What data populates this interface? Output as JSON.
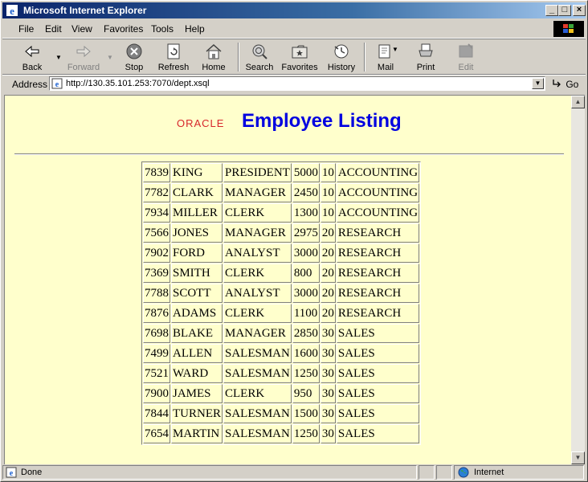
{
  "window": {
    "title": "Microsoft Internet Explorer",
    "controls": [
      "_",
      "□",
      "×"
    ]
  },
  "menu": {
    "items": [
      "File",
      "Edit",
      "View",
      "Favorites",
      "Tools",
      "Help"
    ]
  },
  "toolbar": {
    "back": "Back",
    "forward": "Forward",
    "stop": "Stop",
    "refresh": "Refresh",
    "home": "Home",
    "search": "Search",
    "favorites": "Favorites",
    "history": "History",
    "mail": "Mail",
    "print": "Print",
    "edit": "Edit"
  },
  "address": {
    "label": "Address",
    "url": "http://130.35.101.253:7070/dept.xsql",
    "go": "Go"
  },
  "page": {
    "logo": "ORACLE",
    "title": "Employee Listing",
    "rows": [
      [
        "7839",
        "KING",
        "PRESIDENT",
        "5000",
        "10",
        "ACCOUNTING"
      ],
      [
        "7782",
        "CLARK",
        "MANAGER",
        "2450",
        "10",
        "ACCOUNTING"
      ],
      [
        "7934",
        "MILLER",
        "CLERK",
        "1300",
        "10",
        "ACCOUNTING"
      ],
      [
        "7566",
        "JONES",
        "MANAGER",
        "2975",
        "20",
        "RESEARCH"
      ],
      [
        "7902",
        "FORD",
        "ANALYST",
        "3000",
        "20",
        "RESEARCH"
      ],
      [
        "7369",
        "SMITH",
        "CLERK",
        "800",
        "20",
        "RESEARCH"
      ],
      [
        "7788",
        "SCOTT",
        "ANALYST",
        "3000",
        "20",
        "RESEARCH"
      ],
      [
        "7876",
        "ADAMS",
        "CLERK",
        "1100",
        "20",
        "RESEARCH"
      ],
      [
        "7698",
        "BLAKE",
        "MANAGER",
        "2850",
        "30",
        "SALES"
      ],
      [
        "7499",
        "ALLEN",
        "SALESMAN",
        "1600",
        "30",
        "SALES"
      ],
      [
        "7521",
        "WARD",
        "SALESMAN",
        "1250",
        "30",
        "SALES"
      ],
      [
        "7900",
        "JAMES",
        "CLERK",
        "950",
        "30",
        "SALES"
      ],
      [
        "7844",
        "TURNER",
        "SALESMAN",
        "1500",
        "30",
        "SALES"
      ],
      [
        "7654",
        "MARTIN",
        "SALESMAN",
        "1250",
        "30",
        "SALES"
      ]
    ]
  },
  "status": {
    "left": "Done",
    "zone": "Internet"
  },
  "colors": {
    "titlebar": "#0a246a",
    "page_bg": "#ffffcc",
    "title": "#0000e0",
    "logo": "#d7262b"
  }
}
